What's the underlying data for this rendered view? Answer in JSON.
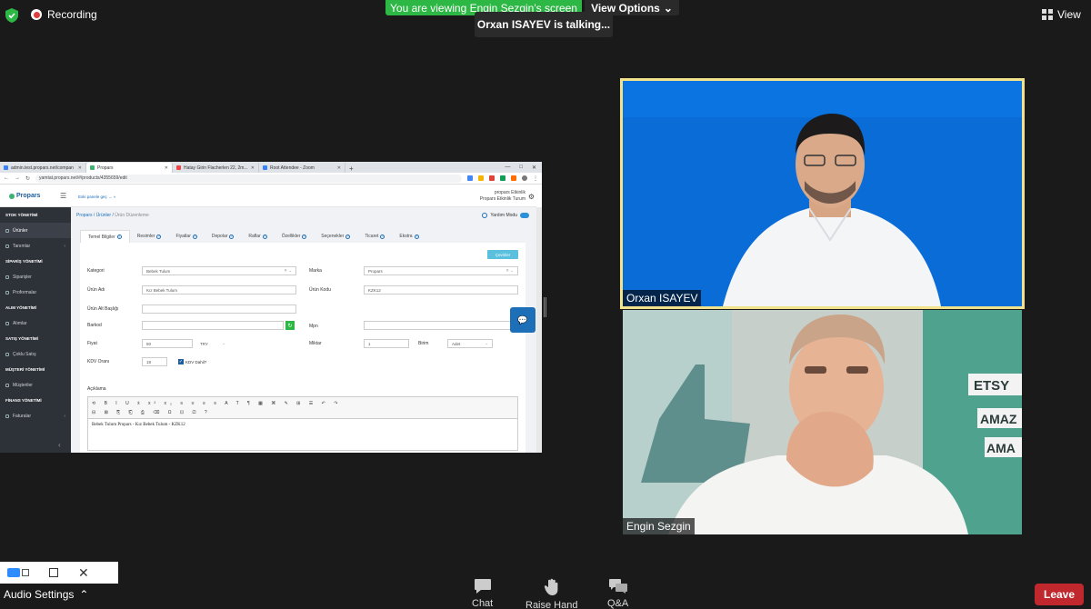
{
  "top": {
    "recording_label": "Recording",
    "viewing_banner": "You are viewing Engin Sezgin's screen",
    "view_options_label": "View Options",
    "talking_status": "Orxan ISAYEV is talking...",
    "view_label": "View"
  },
  "shared_screen": {
    "browser_tabs": [
      {
        "label": "admin.test.propars.net/compan"
      },
      {
        "label": "Propars"
      },
      {
        "label": "Hatay Girin Flacherlen 22, 2m..."
      },
      {
        "label": "Root Attendee - Zoom"
      }
    ],
    "url": "yamtat.propars.net/#/products/4355659/edit",
    "app": {
      "logo": "Propars",
      "old_version_link": "Eski panele geç → »",
      "account_name": "propars Etkinlik",
      "account_sub": "Propars Etkinlik Turum",
      "breadcrumb": [
        "Propars",
        "Ürünler",
        "Ürün Düzenleme"
      ],
      "help_mode_label": "Yardım Modu",
      "sidebar": [
        {
          "label": "STOK YÖNETİMİ",
          "type": "head"
        },
        {
          "label": "Ürünler",
          "type": "item",
          "active": true
        },
        {
          "label": "Tanımlar",
          "type": "item",
          "chevron": true
        },
        {
          "label": "SİPARİŞ YÖNETİMİ",
          "type": "head"
        },
        {
          "label": "Siparişler",
          "type": "item"
        },
        {
          "label": "Proformalar",
          "type": "item"
        },
        {
          "label": "ALIM YÖNETİMİ",
          "type": "head"
        },
        {
          "label": "Alımlar",
          "type": "item"
        },
        {
          "label": "SATIŞ YÖNETİMİ",
          "type": "head"
        },
        {
          "label": "Çoklu Satış",
          "type": "item"
        },
        {
          "label": "MÜŞTERİ YÖNETİMİ",
          "type": "head"
        },
        {
          "label": "Müşteriler",
          "type": "item"
        },
        {
          "label": "FİNANS YÖNETİMİ",
          "type": "head"
        },
        {
          "label": "Faturalar",
          "type": "item",
          "chevron": true
        }
      ],
      "page_tabs": [
        "Temel Bilgiler",
        "Resimler",
        "Fiyatlar",
        "Depolar",
        "Raflar",
        "Özellikler",
        "Seçenekler",
        "Ticaret",
        "Ekstra"
      ],
      "translate_button": "Çeviriler",
      "form": {
        "kategori_label": "Kategori",
        "kategori_value": "Bebek Tulum",
        "marka_label": "Marka",
        "marka_value": "Propars",
        "urun_adi_label": "Ürün Adı",
        "urun_adi_value": "Kız Bebek Tulum",
        "urun_kodu_label": "Ürün Kodu",
        "urun_kodu_value": "KZK12",
        "alt_baslik_label": "Ürün Alt Başlığı",
        "barkod_label": "Barkod",
        "mpn_label": "Mpn",
        "fiyat_label": "Fiyat",
        "fiyat_value": "50",
        "currency_value": "TRY",
        "miktar_label": "Miktar",
        "miktar_value": "1",
        "birim_label": "Birim",
        "birim_value": "Adet",
        "kdv_label": "KDV Oranı",
        "kdv_value": "18",
        "kdv_dahil_label": "KDV Dahil?",
        "aciklama_label": "Açıklama",
        "aciklama_text": "Bebek Tulum Propars - Kız Bebek Tulum - KZK12"
      }
    }
  },
  "participants": [
    {
      "name": "Orxan ISAYEV",
      "active_speaker": true
    },
    {
      "name": "Engin Sezgin",
      "active_speaker": false
    }
  ],
  "bottom": {
    "audio_settings_label": "Audio Settings",
    "chat_label": "Chat",
    "raise_hand_label": "Raise Hand",
    "qa_label": "Q&A",
    "leave_label": "Leave"
  },
  "colors": {
    "banner_green": "#2db745",
    "speaker_border": "#f2e28c",
    "leave_red": "#c0282d"
  }
}
